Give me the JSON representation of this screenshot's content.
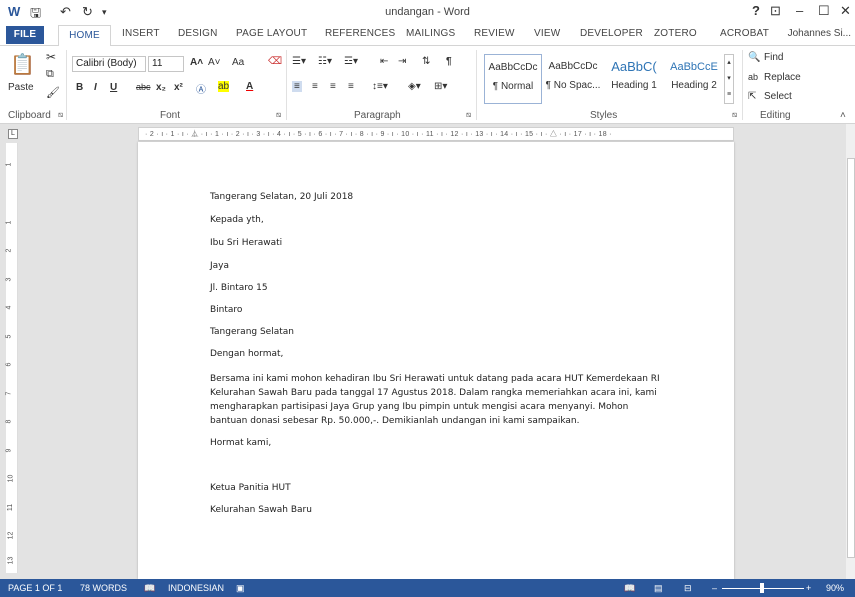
{
  "window": {
    "title": "undangan - Word",
    "help": "?",
    "user": "Johannes Si..."
  },
  "quick_access": {
    "save": "🖫",
    "undo": "↶",
    "redo": "↻"
  },
  "tabs": [
    "FILE",
    "HOME",
    "INSERT",
    "DESIGN",
    "PAGE LAYOUT",
    "REFERENCES",
    "MAILINGS",
    "REVIEW",
    "VIEW",
    "DEVELOPER",
    "ZOTERO",
    "ACROBAT"
  ],
  "ribbon": {
    "clipboard": {
      "label": "Clipboard",
      "paste": "Paste"
    },
    "font": {
      "label": "Font",
      "name": "Calibri (Body)",
      "size": "11",
      "change_case": "Aa"
    },
    "paragraph": {
      "label": "Paragraph"
    },
    "styles": {
      "label": "Styles",
      "items": [
        {
          "preview": "AaBbCcDc",
          "name": "¶ Normal"
        },
        {
          "preview": "AaBbCcDc",
          "name": "¶ No Spac..."
        },
        {
          "preview": "AaBbC(",
          "name": "Heading 1"
        },
        {
          "preview": "AaBbCcE",
          "name": "Heading 2"
        }
      ]
    },
    "editing": {
      "label": "Editing",
      "find": "Find",
      "replace": "Replace",
      "select": "Select"
    }
  },
  "ruler": {
    "top": "· 2 · ı · 1 · ı · ⏅ · ı · 1 · ı · 2 · ı · 3 · ı · 4 · ı · 5 · ı · 6 · ı · 7 · ı · 8 · ı · 9 · ı · 10 · ı · 11 · ı · 12 · ı · 13 · ı · 14 · ı · 15 · ı · △ · ı · 17 · ı · 18 ·",
    "left_numbers": [
      "1",
      "1",
      "2",
      "3",
      "4",
      "5",
      "6",
      "7",
      "8",
      "9",
      "10",
      "11",
      "12",
      "13"
    ]
  },
  "document": {
    "date_line": "Tangerang Selatan, 20 Juli 2018",
    "to": "Kepada yth,",
    "recipient": "Ibu  Sri  Herawati",
    "company": "Jaya",
    "street": "Jl. Bintaro 15",
    "area": "Bintaro",
    "city": "Tangerang Selatan",
    "greeting": "Dengan hormat,",
    "body": "Bersama ini kami mohon kehadiran Ibu Sri Herawati untuk datang pada acara HUT Kemerdekaan RI Kelurahan Sawah Baru pada tanggal  17 Agustus 2018. Dalam rangka memeriahkan acara ini, kami mengharapkan partisipasi Jaya Grup yang Ibu pimpin untuk mengisi acara menyanyi. Mohon bantuan donasi sebesar Rp. 50.000,-. Demikianlah undangan ini kami sampaikan.",
    "closing": "Hormat kami,",
    "signer_title": "Ketua Panitia HUT",
    "signer_org": "Kelurahan Sawah Baru"
  },
  "status": {
    "page": "PAGE 1 OF 1",
    "words": "78 WORDS",
    "language": "INDONESIAN",
    "zoom": "90%"
  },
  "colors": {
    "accent": "#2b579a",
    "ribbon_bg": "#ffffff",
    "workspace": "#e3e3e3"
  }
}
